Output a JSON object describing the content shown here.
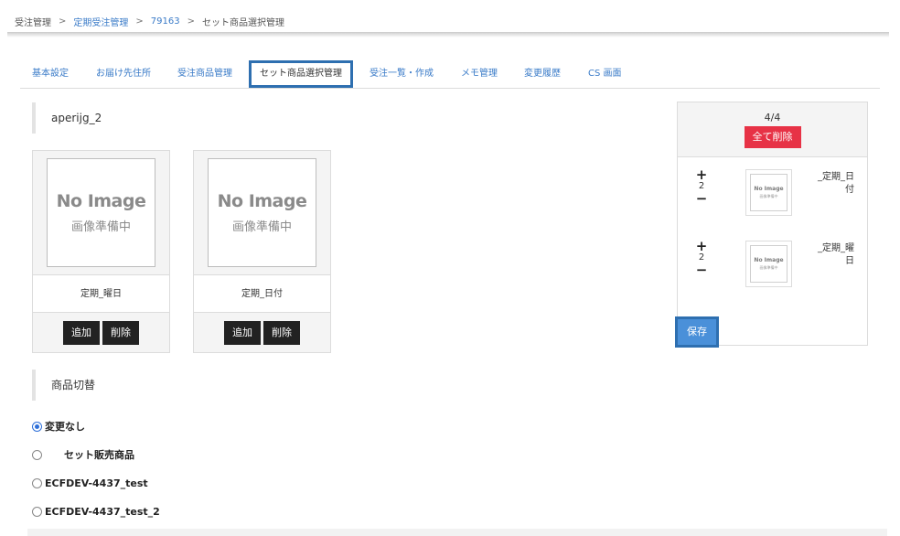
{
  "breadcrumb": {
    "items": [
      "受注管理",
      "定期受注管理",
      "79163",
      "セット商品選択管理"
    ],
    "separator": ">"
  },
  "tabs": [
    {
      "label": "基本設定"
    },
    {
      "label": "お届け先住所"
    },
    {
      "label": "受注商品管理"
    },
    {
      "label": "セット商品選択管理",
      "active": true
    },
    {
      "label": "受注一覧・作成"
    },
    {
      "label": "メモ管理"
    },
    {
      "label": "変更履歴"
    },
    {
      "label": "CS 画面"
    }
  ],
  "set_section": {
    "title": "aperijg_2",
    "products": [
      {
        "image_line1": "No Image",
        "image_line2": "画像準備中",
        "name": "定期_曜日",
        "add_label": "追加",
        "delete_label": "削除"
      },
      {
        "image_line1": "No Image",
        "image_line2": "画像準備中",
        "name": "定期_日付",
        "add_label": "追加",
        "delete_label": "削除"
      }
    ]
  },
  "selection_panel": {
    "count": "4/4",
    "delete_all_label": "全て削除",
    "items": [
      {
        "qty": "2",
        "image_line1": "No Image",
        "image_line2": "画像準備中",
        "name": "_定期_日付"
      },
      {
        "qty": "2",
        "image_line1": "No Image",
        "image_line2": "画像準備中",
        "name": "_定期_曜日"
      }
    ],
    "plus": "+",
    "minus": "−",
    "save_label": "保存"
  },
  "switch_section": {
    "title": "商品切替",
    "options": [
      {
        "label": "変更なし",
        "checked": true
      },
      {
        "label": "セット販売商品",
        "checked": false
      },
      {
        "label": "ECFDEV-4437_test",
        "checked": false
      },
      {
        "label": "ECFDEV-4437_test_2",
        "checked": false
      }
    ]
  },
  "colors": {
    "link": "#3a7bc8",
    "active_tab_border": "#2e6fb0",
    "delete_all": "#e73246",
    "save": "#4a90d9",
    "dark_button": "#222222"
  }
}
